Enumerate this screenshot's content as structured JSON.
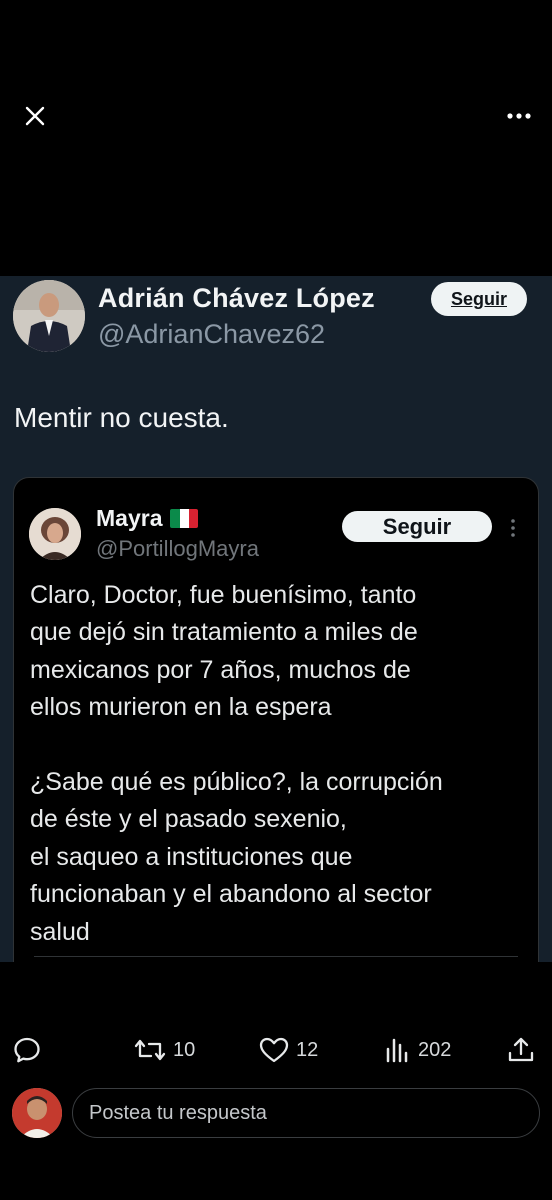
{
  "viewer": {
    "close_icon": "close-icon",
    "more_icon": "more-horizontal-icon"
  },
  "tweet": {
    "author_name": "Adrián Chávez López",
    "author_handle": "@AdrianChavez62",
    "follow_label": "Seguir",
    "text": "Mentir no cuesta."
  },
  "quote": {
    "author_name": "Mayra",
    "author_flag": "mexico-flag",
    "author_handle": "@PortillogMayra",
    "follow_label": "Seguir",
    "paragraphs": [
      [
        "Claro, Doctor, fue buenísimo, tanto",
        "que dejó sin tratamiento a miles de",
        "mexicanos por 7 años, muchos de",
        "ellos murieron en la espera"
      ],
      [
        "¿Sabe qué es público?, la corrupción",
        "de éste y el pasado sexenio,",
        "el saqueo a instituciones que",
        "funcionaban y el abandono al sector",
        "salud"
      ]
    ]
  },
  "actions": {
    "reply_icon": "reply-icon",
    "retweet_count": "10",
    "like_count": "12",
    "views_count": "202",
    "share_icon": "share-icon"
  },
  "reply": {
    "placeholder": "Postea tu respuesta"
  },
  "colors": {
    "background": "#000000",
    "screenshot_bg": "#15202b",
    "button_bg": "#eff3f4",
    "muted_text": "#8b98a5"
  }
}
